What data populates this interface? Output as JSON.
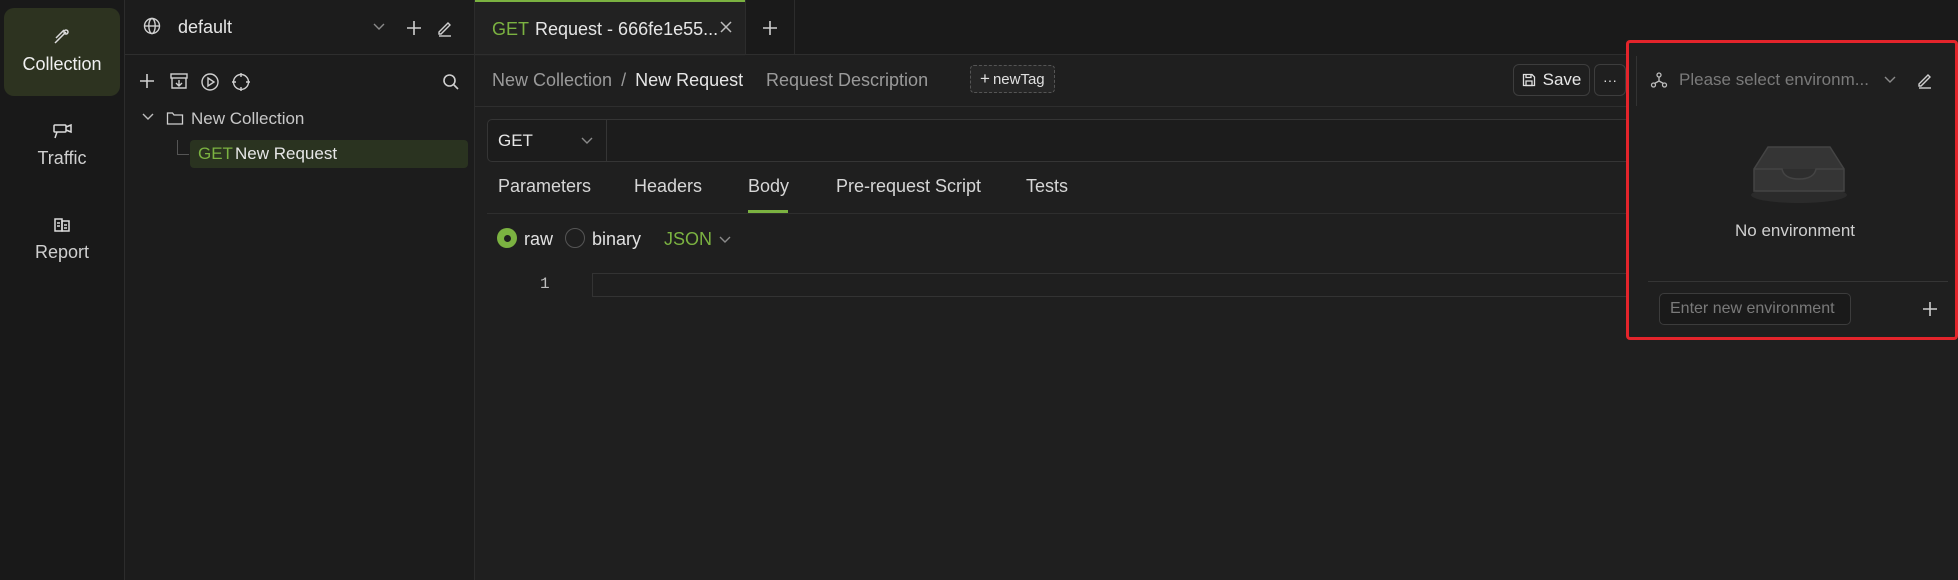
{
  "activity_bar": {
    "items": [
      {
        "label": "Collection",
        "icon": "satellite-icon",
        "active": true
      },
      {
        "label": "Traffic",
        "icon": "camera-icon",
        "active": false
      },
      {
        "label": "Report",
        "icon": "report-icon",
        "active": false
      }
    ]
  },
  "sidebar": {
    "workspace": "default",
    "tree": {
      "collection": "New Collection",
      "request_method": "GET",
      "request_name": "New Request"
    }
  },
  "tabs": [
    {
      "method": "GET",
      "title": "Request - 666fe1e55..."
    }
  ],
  "request": {
    "breadcrumb_collection": "New Collection",
    "breadcrumb_sep": "/",
    "breadcrumb_request": "New Request",
    "description": "Request Description",
    "new_tag": "newTag",
    "save": "Save",
    "more": "···",
    "method": "GET",
    "subtabs": [
      "Parameters",
      "Headers",
      "Body",
      "Pre-request Script",
      "Tests"
    ],
    "active_subtab": "Body",
    "body_modes": {
      "raw": "raw",
      "binary": "binary",
      "format": "JSON"
    },
    "editor_line": "1"
  },
  "environment": {
    "select_placeholder": "Please select environm...",
    "empty_text": "No environment",
    "new_placeholder": "Enter new environment"
  },
  "colors": {
    "accent": "#7bb241",
    "highlight_border": "#e3242b"
  }
}
